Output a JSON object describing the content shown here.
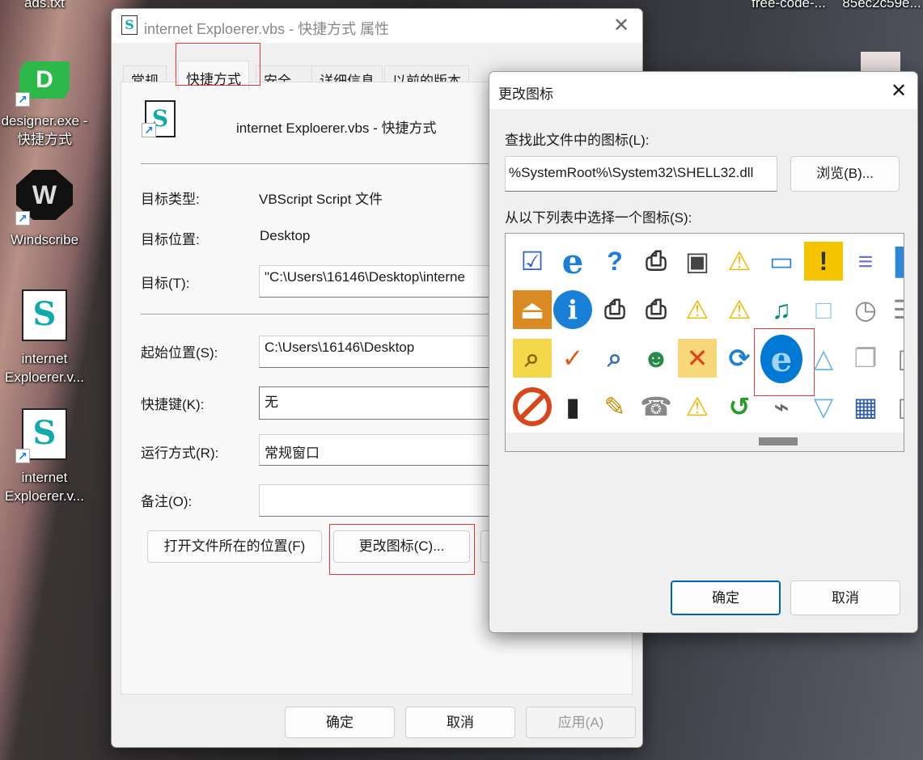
{
  "desktop": {
    "top_labels": [
      "ads.txt",
      "free-code-...",
      "85ec2c59e..."
    ],
    "icons": [
      {
        "label": "designer.exe - 快捷方式",
        "glyph": "D"
      },
      {
        "label": "Windscribe",
        "glyph": "W"
      },
      {
        "label": "internet Exploerer.v...",
        "glyph": "S"
      },
      {
        "label": "internet Exploerer.v...",
        "glyph": "S"
      }
    ]
  },
  "properties": {
    "title": "internet Exploerer.vbs - 快捷方式 属性",
    "tabs": [
      "常规",
      "快捷方式",
      "安全",
      "详细信息",
      "以前的版本"
    ],
    "active_tab": "快捷方式",
    "file_name": "internet Exploerer.vbs - 快捷方式",
    "fields": {
      "target_type_label": "目标类型:",
      "target_type": "VBScript Script 文件",
      "target_location_label": "目标位置:",
      "target_location": "Desktop",
      "target_label": "目标(T):",
      "target": "\"C:\\Users\\16146\\Desktop\\interne",
      "start_in_label": "起始位置(S):",
      "start_in": "C:\\Users\\16146\\Desktop",
      "hotkey_label": "快捷键(K):",
      "hotkey": "无",
      "run_label": "运行方式(R):",
      "run": "常规窗口",
      "comment_label": "备注(O):",
      "comment": ""
    },
    "buttons": {
      "open_location": "打开文件所在的位置(F)",
      "change_icon": "更改图标(C)...",
      "ok": "确定",
      "cancel": "取消",
      "apply": "应用(A)"
    }
  },
  "change_icon": {
    "title": "更改图标",
    "file_label": "查找此文件中的图标(L):",
    "file_path": "%SystemRoot%\\System32\\SHELL32.dll",
    "browse": "浏览(B)...",
    "list_label": "从以下列表中选择一个图标(S):",
    "ok": "确定",
    "cancel": "取消",
    "icons": [
      [
        "checklist",
        "internet-explorer",
        "help-document",
        "printer-paused",
        "computer",
        "warning",
        "window",
        "shield-warning",
        "filter",
        "panel"
      ],
      [
        "eject",
        "info",
        "printer",
        "printer-paused",
        "warning",
        "warning",
        "multimedia",
        "blank-square",
        "clock",
        "document"
      ],
      [
        "card-search",
        "printer-check",
        "printer-search",
        "printer-users",
        "folder-delete",
        "sync",
        "internet-explorer",
        "triangle-up",
        "stacked-pages",
        "column"
      ],
      [
        "prohibited",
        "server-check",
        "printer-doc",
        "fax",
        "warning",
        "clock-restore",
        "usb-drive",
        "triangle-down",
        "grid-window",
        "column"
      ]
    ],
    "selected": [
      2,
      6
    ]
  }
}
